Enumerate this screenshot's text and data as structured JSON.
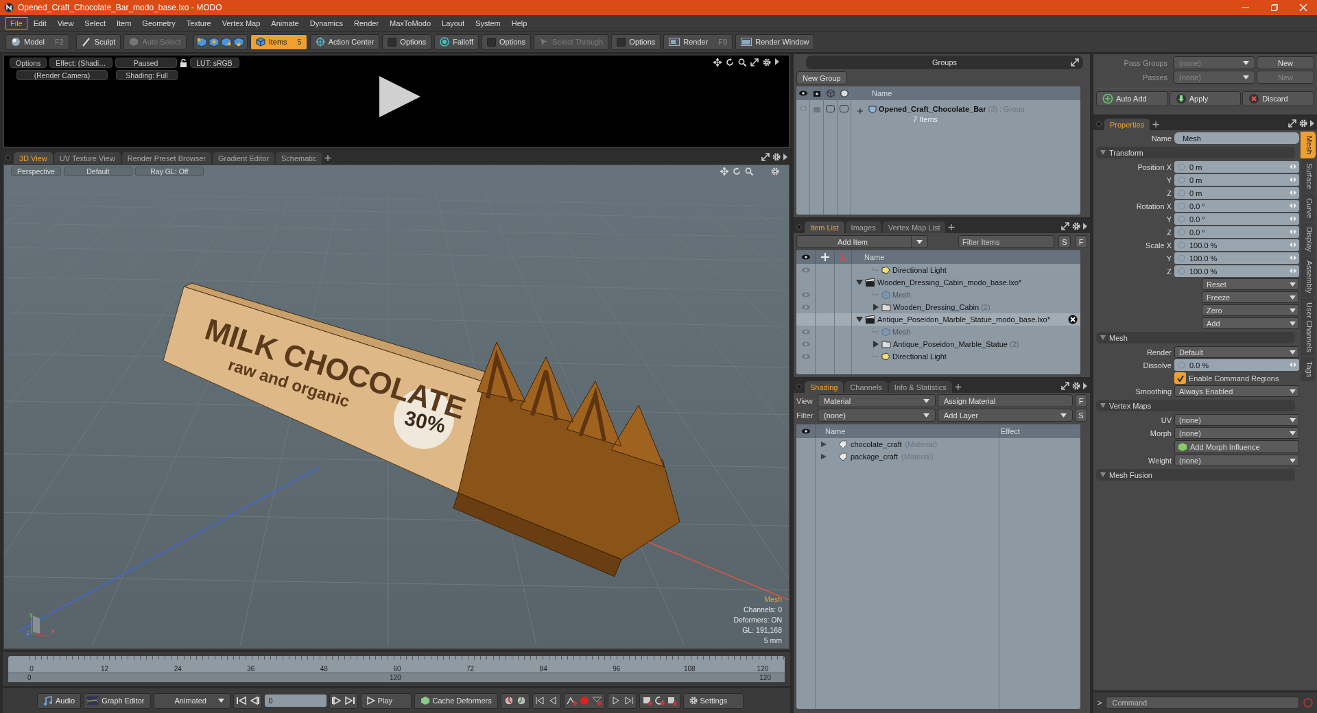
{
  "window": {
    "title": "Opened_Craft_Chocolate_Bar_modo_base.lxo - MODO"
  },
  "menu": [
    {
      "label": "File",
      "selected": true
    },
    {
      "label": "Edit",
      "selected": false
    },
    {
      "label": "View",
      "selected": false
    },
    {
      "label": "Select",
      "selected": false
    },
    {
      "label": "Item",
      "selected": false
    },
    {
      "label": "Geometry",
      "selected": false
    },
    {
      "label": "Texture",
      "selected": false
    },
    {
      "label": "Vertex Map",
      "selected": false
    },
    {
      "label": "Animate",
      "selected": false
    },
    {
      "label": "Dynamics",
      "selected": false
    },
    {
      "label": "Render",
      "selected": false
    },
    {
      "label": "MaxToModo",
      "selected": false
    },
    {
      "label": "Layout",
      "selected": false
    },
    {
      "label": "System",
      "selected": false
    },
    {
      "label": "Help",
      "selected": false
    }
  ],
  "toolbar": [
    {
      "kind": "model",
      "label": "Model",
      "shortcut": "F2",
      "selected": false,
      "disabled": false
    },
    {
      "kind": "sculpt",
      "label": "Sculpt",
      "selected": false,
      "disabled": false
    },
    {
      "kind": "auto-select",
      "label": "Auto Select",
      "selected": false,
      "disabled": true
    },
    {
      "kind": "items",
      "label": "Items",
      "shortcut": "5",
      "selected": true,
      "disabled": false
    },
    {
      "kind": "action-center",
      "label": "Action Center",
      "selected": false,
      "disabled": false
    },
    {
      "kind": "options",
      "label": "Options",
      "selected": false,
      "disabled": false
    },
    {
      "kind": "falloff",
      "label": "Falloff",
      "selected": false,
      "disabled": false
    },
    {
      "kind": "options",
      "label": "Options",
      "selected": false,
      "disabled": false
    },
    {
      "kind": "select-through",
      "label": "Select Through",
      "selected": false,
      "disabled": true
    },
    {
      "kind": "options",
      "label": "Options",
      "selected": false,
      "disabled": false
    },
    {
      "kind": "render",
      "label": "Render",
      "shortcut": "F9",
      "selected": false,
      "disabled": false
    },
    {
      "kind": "render-window",
      "label": "Render Window",
      "selected": false,
      "disabled": false
    }
  ],
  "render_preview": {
    "controls_row_1": [
      "Options",
      "Effect: (Shadi…",
      "Paused",
      "LUT: sRGB"
    ],
    "controls_row_2": [
      "(Render Camera)",
      "Shading: Full"
    ]
  },
  "viewport": {
    "tabs": [
      {
        "label": "3D View",
        "selected": true
      },
      {
        "label": "UV Texture View",
        "selected": false
      },
      {
        "label": "Render Preset Browser",
        "selected": false
      },
      {
        "label": "Gradient Editor",
        "selected": false
      },
      {
        "label": "Schematic",
        "selected": false
      }
    ],
    "header": [
      "Perspective",
      "Default",
      "Ray GL: Off"
    ],
    "model_text": {
      "title": "MILK CHOCOLATE",
      "subtitle": "raw and organic",
      "badge": "30%"
    },
    "info": {
      "selection": "Mesh",
      "lines": [
        "Channels: 0",
        "Deformers: ON",
        "GL: 191,168",
        "5 mm"
      ]
    },
    "gizmo_axes": [
      "X",
      "Y",
      "Z"
    ]
  },
  "timeline": {
    "ticks": [
      "0",
      "12",
      "24",
      "36",
      "48",
      "60",
      "72",
      "84",
      "96",
      "108",
      "120"
    ],
    "range": [
      "0",
      "120",
      "120"
    ]
  },
  "transport": {
    "audio": "Audio",
    "graph_editor": "Graph Editor",
    "mode": "Animated",
    "frame": "0",
    "play": "Play",
    "cache": "Cache Deformers",
    "settings": "Settings"
  },
  "groups": {
    "title": "Groups",
    "new_button": "New Group",
    "column": "Name",
    "rows": [
      {
        "name": "Opened_Craft_Chocolate_Bar",
        "count": "(3)",
        "type": ": Group",
        "detail": "7 Items",
        "expanded": false
      }
    ]
  },
  "item_list": {
    "tabs": [
      {
        "label": "Item List",
        "selected": true
      },
      {
        "label": "Images",
        "selected": false
      },
      {
        "label": "Vertex Map List",
        "selected": false
      }
    ],
    "add_item": "Add Item",
    "filter_placeholder": "Filter Items",
    "buttons": [
      "S",
      "F"
    ],
    "column": "Name",
    "items": [
      {
        "name": "Directional Light",
        "kind": "light",
        "visible": true,
        "selected": false
      },
      {
        "name": "Wooden_Dressing_Cabin_modo_base.lxo*",
        "kind": "scene",
        "visible": false,
        "selected": false,
        "expanded": true,
        "children": [
          {
            "name": "Mesh",
            "kind": "mesh",
            "visible": true,
            "selected": false
          },
          {
            "name": "Wooden_Dressing_Cabin",
            "count": "(2)",
            "kind": "group",
            "visible": true,
            "selected": false,
            "expanded": false
          }
        ]
      },
      {
        "name": "Antique_Poseidon_Marble_Statue_modo_base.lxo*",
        "kind": "scene",
        "visible": false,
        "selected": true,
        "expanded": true,
        "children": [
          {
            "name": "Mesh",
            "kind": "mesh",
            "visible": true,
            "selected": false
          },
          {
            "name": "Antique_Poseidon_Marble_Statue",
            "count": "(2)",
            "kind": "group",
            "visible": true,
            "selected": false,
            "expanded": false
          },
          {
            "name": "Directional Light",
            "kind": "light",
            "visible": true,
            "selected": false
          }
        ]
      }
    ]
  },
  "shading": {
    "tabs": [
      {
        "label": "Shading",
        "selected": true
      },
      {
        "label": "Channels",
        "selected": false
      },
      {
        "label": "Info & Statistics",
        "selected": false
      }
    ],
    "view_label": "View",
    "view_value": "Material",
    "assign": "Assign Material",
    "assign_key": "F",
    "filter_label": "Filter",
    "filter_value": "(none)",
    "add_layer": "Add Layer",
    "add_key": "S",
    "columns": [
      "Name",
      "Effect"
    ],
    "rows": [
      {
        "name": "chocolate_craft",
        "type": "(Material)",
        "expanded": false
      },
      {
        "name": "package_craft",
        "type": "(Material)",
        "expanded": false
      }
    ]
  },
  "passes": {
    "rows": [
      {
        "label": "Pass Groups",
        "value": "(none)",
        "button": "New",
        "disabled": false
      },
      {
        "label": "Passes",
        "value": "(none)",
        "button": "New",
        "disabled": true
      }
    ],
    "actions": [
      {
        "kind": "auto-add",
        "label": "Auto Add"
      },
      {
        "kind": "apply",
        "label": "Apply"
      },
      {
        "kind": "discard",
        "label": "Discard"
      }
    ]
  },
  "properties": {
    "tab": "Properties",
    "name_label": "Name",
    "name_value": "Mesh",
    "sections": [
      {
        "title": "Transform",
        "rows": [
          {
            "kind": "vector",
            "label": "Position X",
            "value": "0 m"
          },
          {
            "kind": "vector",
            "label": "Y",
            "value": "0 m"
          },
          {
            "kind": "vector",
            "label": "Z",
            "value": "0 m"
          },
          {
            "kind": "vector",
            "label": "Rotation X",
            "value": "0.0 °"
          },
          {
            "kind": "vector",
            "label": "Y",
            "value": "0.0 °"
          },
          {
            "kind": "vector",
            "label": "Z",
            "value": "0.0 °"
          },
          {
            "kind": "vector",
            "label": "Scale X",
            "value": "100.0 %"
          },
          {
            "kind": "vector",
            "label": "Y",
            "value": "100.0 %"
          },
          {
            "kind": "vector",
            "label": "Z",
            "value": "100.0 %"
          },
          {
            "kind": "menu",
            "value": "Reset"
          },
          {
            "kind": "menu",
            "value": "Freeze"
          },
          {
            "kind": "menu",
            "value": "Zero"
          },
          {
            "kind": "menu",
            "value": "Add"
          }
        ]
      },
      {
        "title": "Mesh",
        "rows": [
          {
            "kind": "dropdown",
            "label": "Render",
            "value": "Default"
          },
          {
            "kind": "number",
            "label": "Dissolve",
            "value": "0.0 %"
          },
          {
            "kind": "checkbox",
            "value": "Enable Command Regions",
            "checked": true
          },
          {
            "kind": "dropdown",
            "label": "Smoothing",
            "value": "Always Enabled"
          }
        ]
      },
      {
        "title": "Vertex Maps",
        "rows": [
          {
            "kind": "dropdown",
            "label": "UV",
            "value": "(none)"
          },
          {
            "kind": "dropdown",
            "label": "Morph",
            "value": "(none)"
          },
          {
            "kind": "button",
            "value": "Add Morph Influence"
          },
          {
            "kind": "dropdown",
            "label": "Weight",
            "value": "(none)"
          }
        ]
      },
      {
        "title": "Mesh Fusion"
      }
    ],
    "side_tabs": [
      {
        "label": "Mesh",
        "selected": true
      },
      {
        "label": "Surface",
        "selected": false
      },
      {
        "label": "Curve",
        "selected": false
      },
      {
        "label": "Display",
        "selected": false
      },
      {
        "label": "Assembly",
        "selected": false
      },
      {
        "label": "User Channels",
        "selected": false
      },
      {
        "label": "Tags",
        "selected": false
      }
    ]
  },
  "command": {
    "prompt": ">",
    "placeholder": "Command"
  }
}
